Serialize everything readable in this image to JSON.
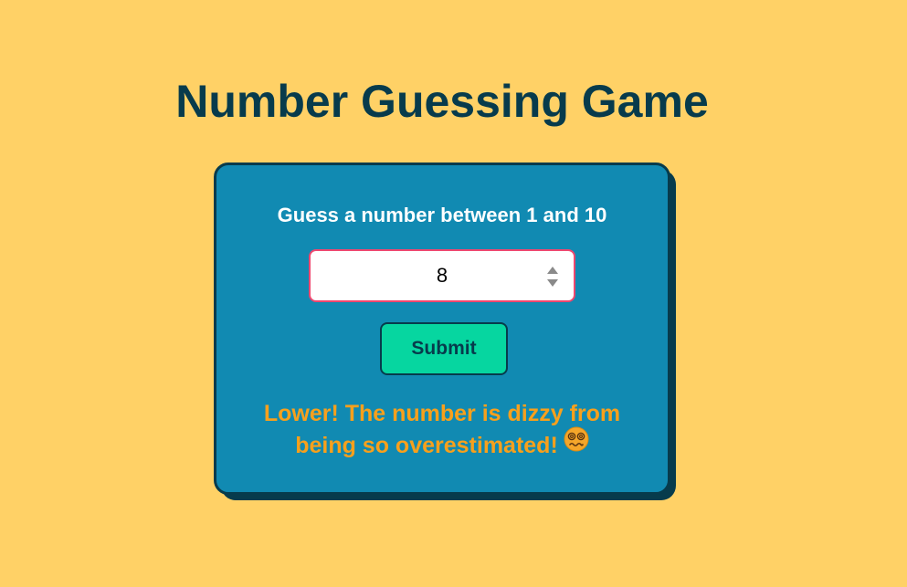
{
  "game": {
    "title": "Number Guessing Game",
    "prompt": "Guess a number between 1 and 10",
    "guess_value": "8",
    "submit_label": "Submit",
    "feedback": "Lower! The number is dizzy from being so overestimated!",
    "feedback_icon": "dizzy-face-emoji"
  },
  "colors": {
    "background": "#ffd166",
    "card": "#118ab2",
    "card_border": "#073b4c",
    "input_border": "#ef476f",
    "button": "#06d6a0",
    "feedback_text": "#f7a01c"
  }
}
